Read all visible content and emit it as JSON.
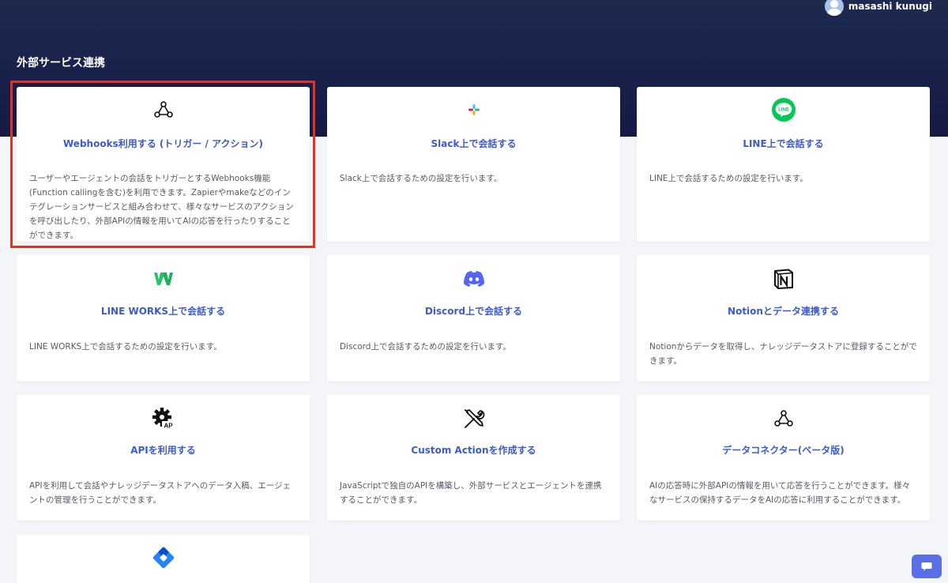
{
  "header": {
    "page_title": "外部サービス連携",
    "user_name": "masashi kunugi"
  },
  "cards": [
    {
      "icon": "webhook-icon",
      "title": "Webhooks利用する (トリガー / アクション)",
      "description": "ユーザーやエージェントの会話をトリガーとするWebhooks機能(Function callingを含む)を利用できます。Zapierやmakeなどのインテグレーションサービスと組み合わせて、様々なサービスのアクションを呼び出したり、外部APIの情報を用いてAIの応答を行ったりすることができます。"
    },
    {
      "icon": "slack-icon",
      "title": "Slack上で会話する",
      "description": "Slack上で会話するための設定を行います。"
    },
    {
      "icon": "line-icon",
      "title": "LINE上で会話する",
      "description": "LINE上で会話するための設定を行います。"
    },
    {
      "icon": "line-works-icon",
      "title": "LINE WORKS上で会話する",
      "description": "LINE WORKS上で会話するための設定を行います。"
    },
    {
      "icon": "discord-icon",
      "title": "Discord上で会話する",
      "description": "Discord上で会話するための設定を行います。"
    },
    {
      "icon": "notion-icon",
      "title": "Notionとデータ連携する",
      "description": "Notionからデータを取得し、ナレッジデータストアに登録することができます。"
    },
    {
      "icon": "api-gear-icon",
      "title": "APIを利用する",
      "description": "APIを利用して会話やナレッジデータストアへのデータ入稿、エージェントの管理を行うことができます。"
    },
    {
      "icon": "tools-icon",
      "title": "Custom Actionを作成する",
      "description": "JavaScriptで独自のAPIを構築し、外部サービスとエージェントを連携することができます。"
    },
    {
      "icon": "webhook-icon",
      "title": "データコネクター(ベータ版)",
      "description": "AIの応答時に外部APIの情報を用いて応答を行うことができます。様々なサービスの保持するデータをAIの応答に利用することができます。"
    },
    {
      "icon": "jira-icon",
      "title": "",
      "description": ""
    }
  ],
  "colors": {
    "header_bg": "#18204a",
    "card_title": "#3d5bc9",
    "highlight": "#e3321f",
    "chat_button": "#5a6fe3"
  }
}
